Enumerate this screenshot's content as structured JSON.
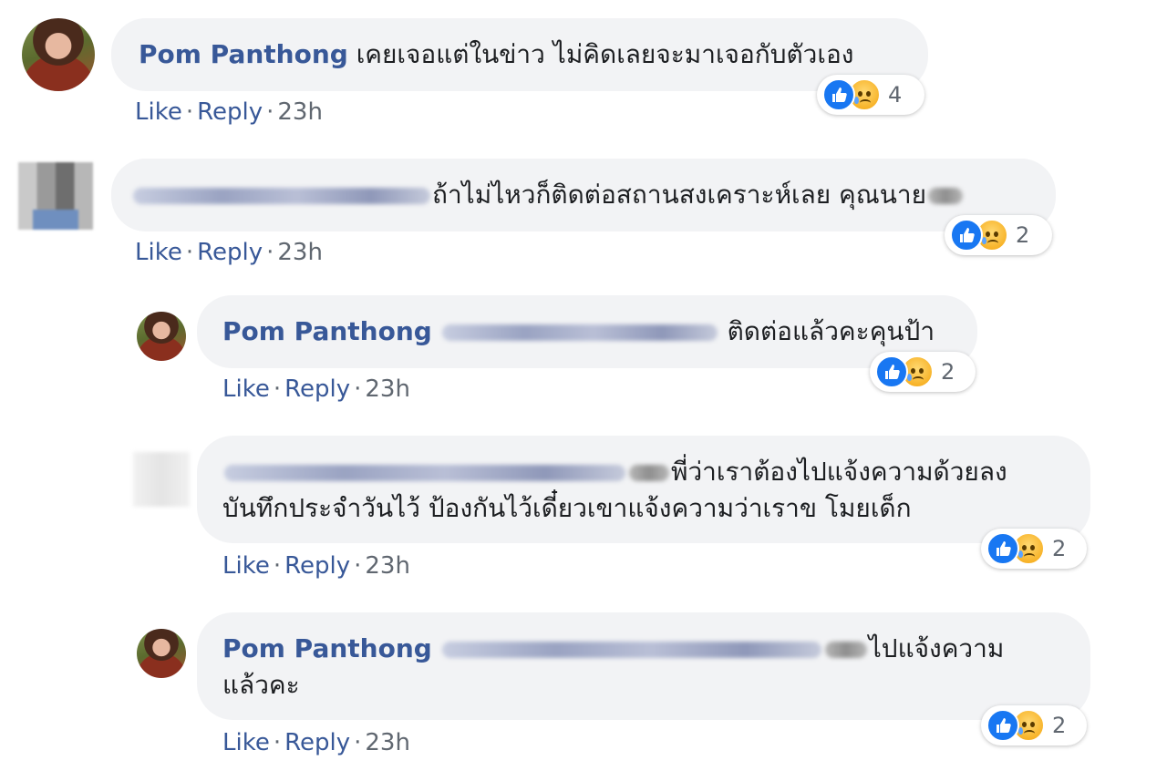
{
  "comments": [
    {
      "author": "Pom Panthong",
      "text": "เคยเจอแต่ในข่าว ไม่คิดเลยจะมาเจอกับตัวเอง",
      "reaction_count": "4"
    },
    {
      "author": "",
      "text": "ถ้าไม่ไหวก็ติดต่อสถานสงเคราะห์เลย คุณนาย",
      "reaction_count": "2"
    },
    {
      "author": "Pom Panthong",
      "text": "ติดต่อแล้วคะคุนป้า",
      "reaction_count": "2"
    },
    {
      "author": "",
      "text_line1": "พี่ว่าเราต้องไปแจ้งความด้วยลง",
      "text_line2": "บันทึกประจำวันไว้ ป้องกันไว้เดี๋ยวเขาแจ้งความว่าเราข โมยเด็ก",
      "reaction_count": "2"
    },
    {
      "author": "Pom Panthong",
      "text_line1": "ไปแจ้งความ",
      "text_line2": "แล้วคะ",
      "reaction_count": "2"
    }
  ],
  "meta": {
    "like_label": "Like",
    "reply_label": "Reply",
    "separator": "·",
    "time": "23h"
  },
  "icons": {
    "like": "like-reaction-icon",
    "sad": "sad-reaction-icon"
  },
  "colors": {
    "author": "#385898",
    "bubble": "#f2f3f5",
    "like_blue": "#1877f2"
  }
}
